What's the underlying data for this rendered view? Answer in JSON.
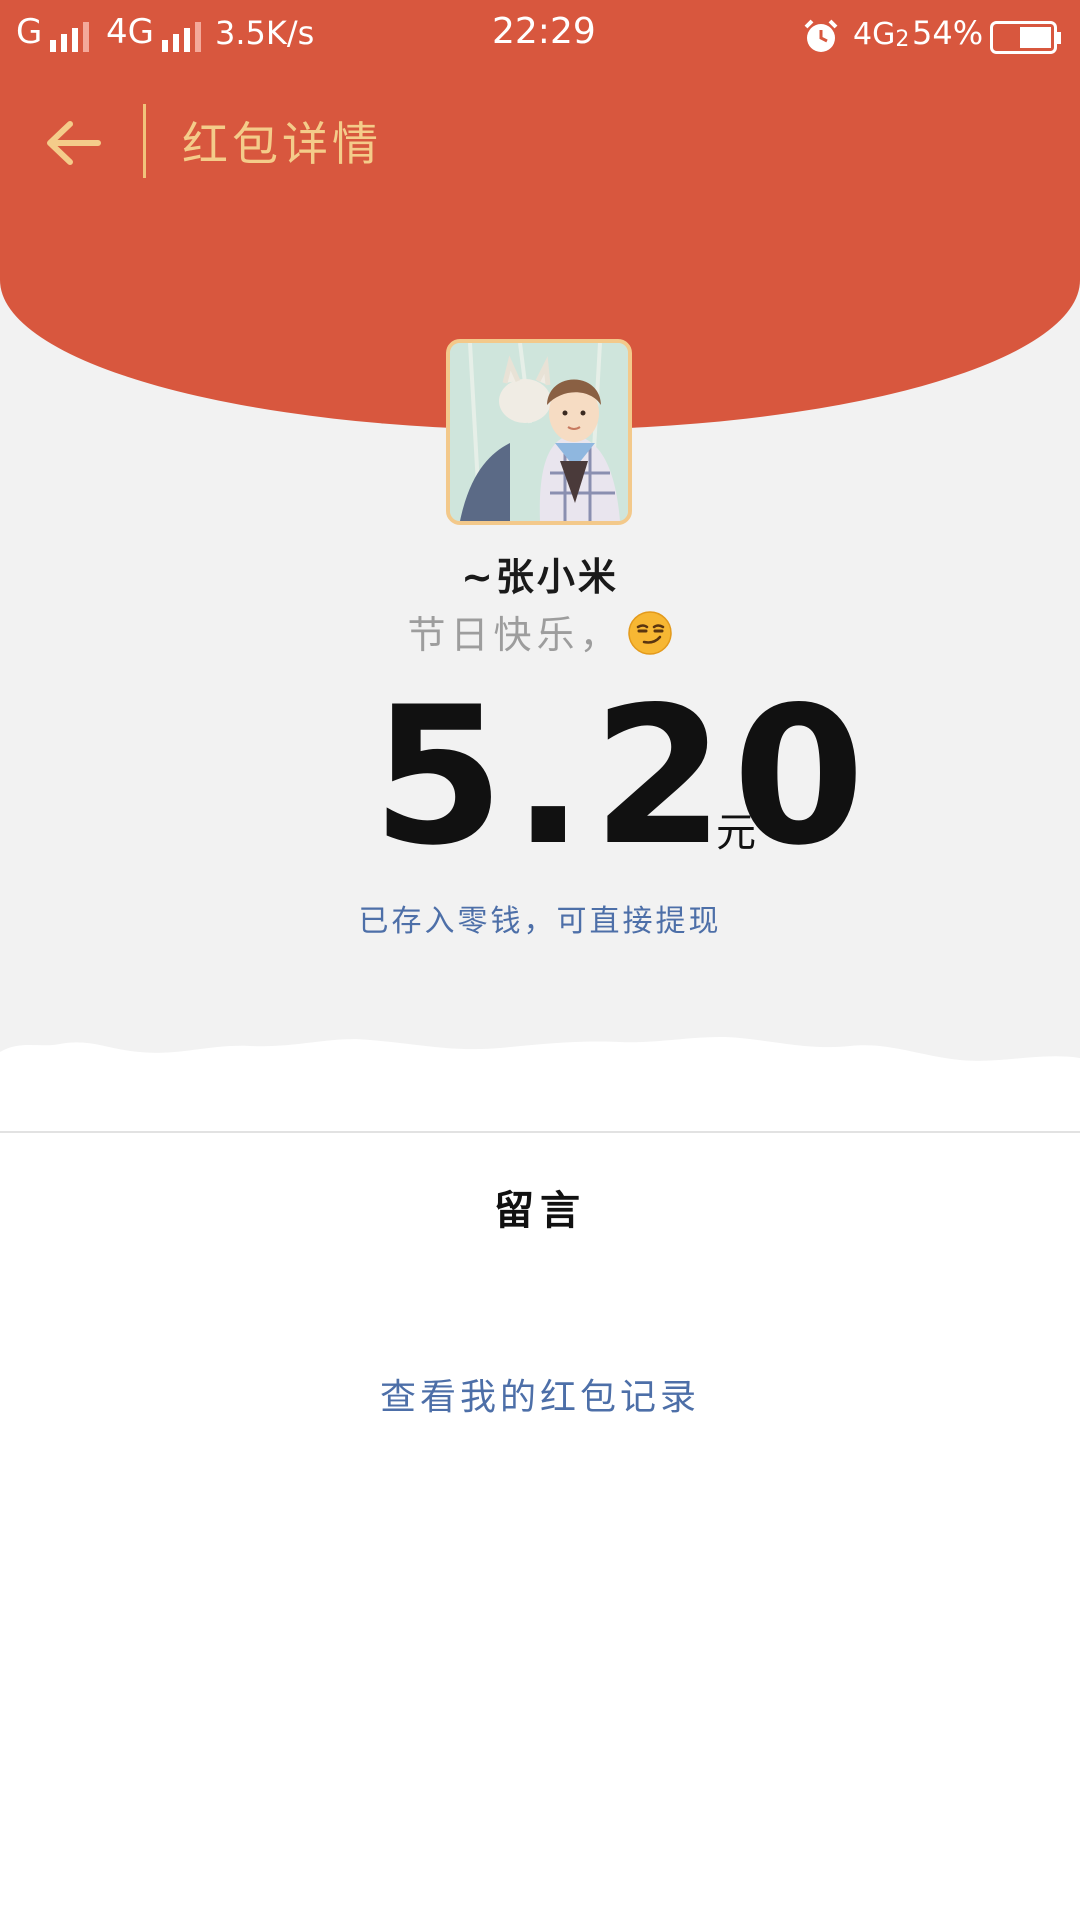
{
  "status_bar": {
    "carrier1": "G",
    "carrier2": "4G",
    "speed": "3.5K/s",
    "time": "22:29",
    "network": "4G",
    "sim": "2",
    "battery": "54%"
  },
  "nav": {
    "title": "红包详情",
    "back_icon": "back-arrow-icon"
  },
  "colors": {
    "header_red": "#d8573e",
    "gold": "#f4cc8a",
    "link_blue": "#4d6fa8"
  },
  "sender": {
    "name": "~张小米",
    "greeting": "节日快乐，",
    "emoji": "smirk-emoji"
  },
  "amount": {
    "value": "5.20",
    "unit": "元",
    "note": "已存入零钱，可直接提现"
  },
  "message": {
    "label": "留言"
  },
  "records": {
    "link": "查看我的红包记录"
  }
}
